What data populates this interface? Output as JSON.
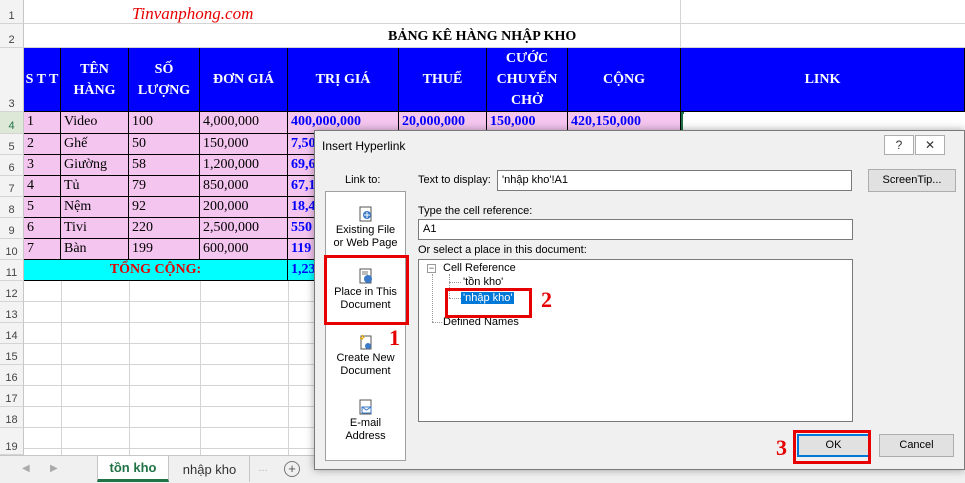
{
  "watermark": "Tinvanphong.com",
  "sheet_title": "BẢNG KÊ HÀNG NHẬP KHO",
  "row_numbers": [
    "1",
    "2",
    "3",
    "4",
    "5",
    "6",
    "7",
    "8",
    "9",
    "10",
    "11",
    "12",
    "13",
    "14",
    "15",
    "16",
    "17",
    "18",
    "19"
  ],
  "headers": {
    "stt": "S T T",
    "ten_hang": "TÊN HÀNG",
    "so_luong": "SỐ LƯỢNG",
    "don_gia": "ĐƠN GIÁ",
    "tri_gia": "TRỊ GIÁ",
    "thue": "THUẾ",
    "cuoc": "CƯỚC CHUYỂN CHỞ",
    "cong": "CỘNG",
    "link": "LINK"
  },
  "rows": [
    {
      "stt": "1",
      "ten": "Video",
      "sl": "100",
      "dg": "4,000,000",
      "tg": "400,000,000",
      "thue": "20,000,000",
      "cuoc": "150,000",
      "cong": "420,150,000"
    },
    {
      "stt": "2",
      "ten": "Ghế",
      "sl": "50",
      "dg": "150,000",
      "tg": "7,50",
      "thue": "",
      "cuoc": "",
      "cong": ""
    },
    {
      "stt": "3",
      "ten": "Giường",
      "sl": "58",
      "dg": "1,200,000",
      "tg": "69,6",
      "thue": "",
      "cuoc": "",
      "cong": ""
    },
    {
      "stt": "4",
      "ten": "Tủ",
      "sl": "79",
      "dg": "850,000",
      "tg": "67,1",
      "thue": "",
      "cuoc": "",
      "cong": ""
    },
    {
      "stt": "5",
      "ten": "Nệm",
      "sl": "92",
      "dg": "200,000",
      "tg": "18,4",
      "thue": "",
      "cuoc": "",
      "cong": ""
    },
    {
      "stt": "6",
      "ten": "Tivi",
      "sl": "220",
      "dg": "2,500,000",
      "tg": "550",
      "thue": "",
      "cuoc": "",
      "cong": ""
    },
    {
      "stt": "7",
      "ten": "Bàn",
      "sl": "199",
      "dg": "600,000",
      "tg": "119",
      "thue": "",
      "cuoc": "",
      "cong": ""
    }
  ],
  "total_label": "TỔNG CỘNG:",
  "total_value": "1,23",
  "sheet_tabs": [
    "tồn kho",
    "nhập kho"
  ],
  "add_sheet": "+",
  "dialog": {
    "title": "Insert Hyperlink",
    "help_btn": "?",
    "close_btn": "✕",
    "link_to": "Link to:",
    "link_options": [
      {
        "line1": "Existing File",
        "line2": "or Web Page",
        "icon": "existing-file-icon"
      },
      {
        "line1": "Place in This",
        "line2": "Document",
        "icon": "place-in-document-icon"
      },
      {
        "line1": "Create New",
        "line2": "Document",
        "icon": "create-new-document-icon"
      },
      {
        "line1": "E-mail",
        "line2": "Address",
        "icon": "email-address-icon"
      }
    ],
    "text_to_display_label": "Text to display:",
    "text_to_display_value": "'nhập kho'!A1",
    "screentip": "ScreenTip...",
    "cell_ref_label": "Type the cell reference:",
    "cell_ref_value": "A1",
    "select_place_label": "Or select a place in this document:",
    "tree": {
      "root": "Cell Reference",
      "children": [
        "'tồn kho'",
        "'nhập kho'"
      ],
      "defined_names": "Defined Names",
      "expander": "−"
    },
    "ok": "OK",
    "cancel": "Cancel"
  },
  "annotations": [
    "1",
    "2",
    "3"
  ],
  "colors": {
    "header_blue": "#0000ff",
    "row_pink": "#f4c5ef",
    "total_cyan": "#00ffff",
    "accent_red": "#e60000",
    "selection_blue": "#0078d7",
    "excel_green": "#217346"
  }
}
